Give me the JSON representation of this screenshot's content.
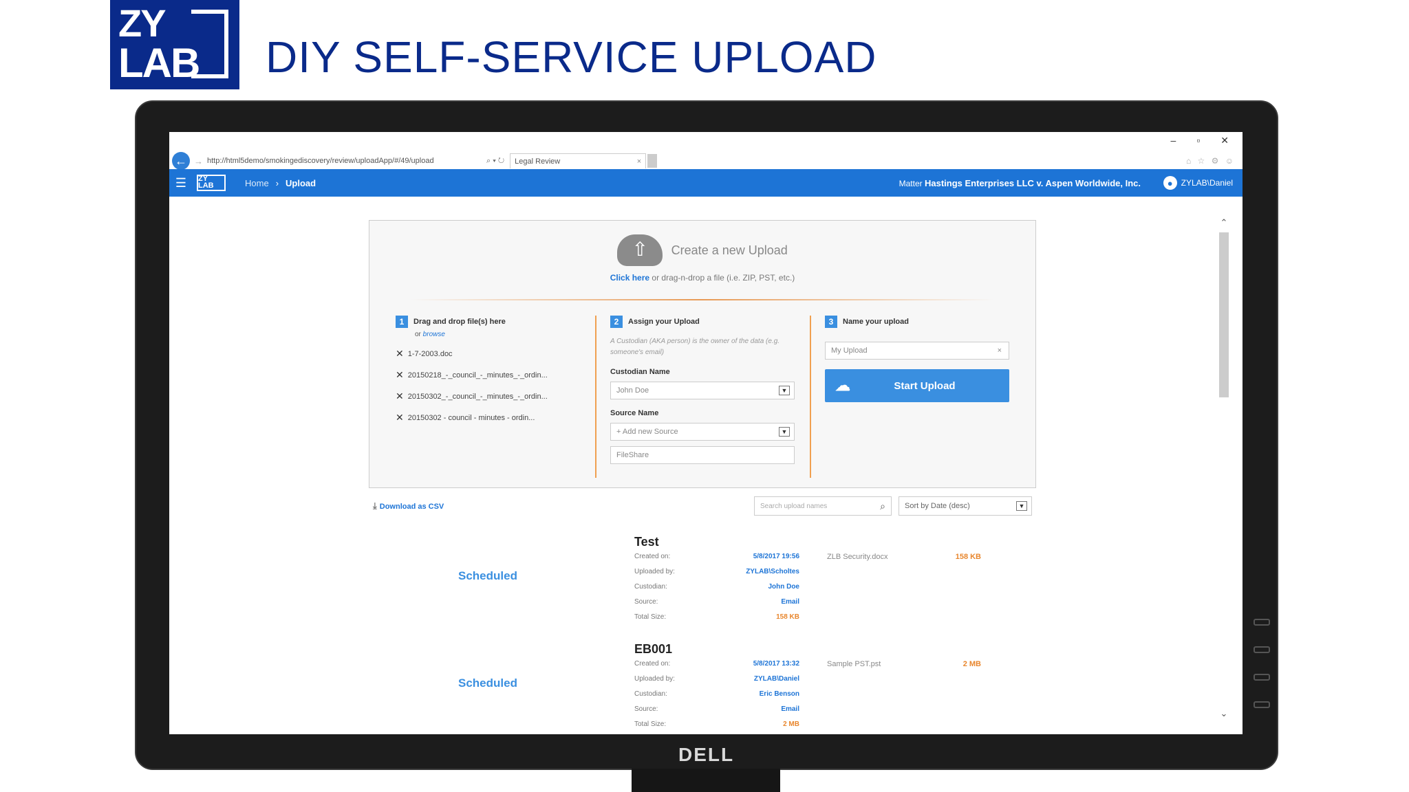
{
  "slide": {
    "title": "DIY SELF-SERVICE UPLOAD",
    "logo_top": "ZY",
    "logo_bottom": "LAB",
    "monitor_brand": "DELL"
  },
  "browser": {
    "url": "http://html5demo/smokingediscovery/review/uploadApp/#/49/upload",
    "tab_title": "Legal Review",
    "win_min": "–",
    "win_restore": "▫",
    "win_close": "✕"
  },
  "appbar": {
    "menu_glyph": "☰",
    "logo": "ZY LAB",
    "crumb_home": "Home",
    "crumb_sep": "›",
    "crumb_current": "Upload",
    "matter_label": "Matter",
    "matter_value": "Hastings Enterprises LLC v. Aspen Worldwide, Inc.",
    "user": "ZYLAB\\Daniel"
  },
  "create": {
    "title": "Create a new Upload",
    "click_here": "Click here",
    "sub_rest": " or drag-n-drop a file (i.e. ZIP, PST, etc.)"
  },
  "step1": {
    "num": "1",
    "title": "Drag and drop file(s) here",
    "or": "or ",
    "browse": "browse",
    "files": [
      "1-7-2003.doc",
      "20150218_-_council_-_minutes_-_ordin...",
      "20150302_-_council_-_minutes_-_ordin...",
      "20150302 - council - minutes - ordin..."
    ]
  },
  "step2": {
    "num": "2",
    "title": "Assign your Upload",
    "hint": "A Custodian (AKA person) is the owner of the data (e.g. someone's email)",
    "custodian_label": "Custodian Name",
    "custodian_value": "John Doe",
    "source_label": "Source Name",
    "source_value": "+ Add new Source",
    "source_input": "FileShare"
  },
  "step3": {
    "num": "3",
    "title": "Name your upload",
    "name_value": "My Upload",
    "start_label": "Start Upload"
  },
  "tools": {
    "csv_label": "Download as CSV",
    "search_placeholder": "Search upload names",
    "sort_value": "Sort by Date (desc)"
  },
  "meta_labels": {
    "created": "Created on:",
    "uploaded": "Uploaded by:",
    "custodian": "Custodian:",
    "source": "Source:",
    "total": "Total Size:"
  },
  "uploads": [
    {
      "name": "Test",
      "status": "Scheduled",
      "created": "5/8/2017 19:56",
      "uploaded_by": "ZYLAB\\Scholtes",
      "custodian": "John Doe",
      "source": "Email",
      "total_size": "158 KB",
      "file_name": "ZLB Security.docx",
      "file_size": "158 KB"
    },
    {
      "name": "EB001",
      "status": "Scheduled",
      "created": "5/8/2017 13:32",
      "uploaded_by": "ZYLAB\\Daniel",
      "custodian": "Eric Benson",
      "source": "Email",
      "total_size": "2 MB",
      "file_name": "Sample PST.pst",
      "file_size": "2 MB"
    }
  ],
  "colors": {
    "brand_navy": "#0a2a8a",
    "app_blue": "#1d74d6",
    "accent_orange": "#e8862d"
  }
}
